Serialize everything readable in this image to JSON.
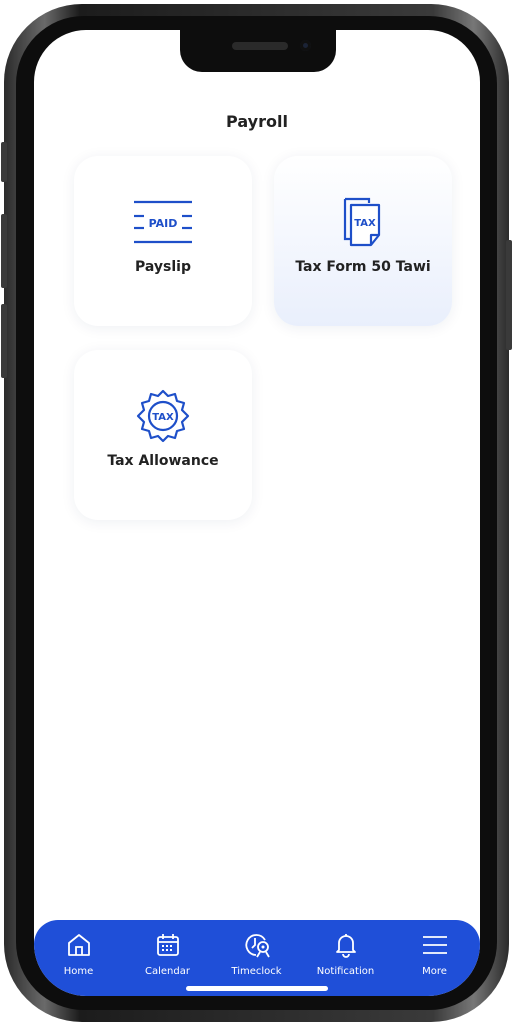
{
  "header": {
    "title": "Payroll"
  },
  "cards": [
    {
      "label": "Payslip",
      "icon": "paid-stamp-icon",
      "badge_text": "PAID"
    },
    {
      "label": "Tax Form 50 Tawi",
      "icon": "tax-form-icon",
      "badge_text": "TAX",
      "selected": true
    },
    {
      "label": "Tax Allowance",
      "icon": "tax-badge-icon",
      "badge_text": "TAX"
    }
  ],
  "bottom_nav": {
    "items": [
      {
        "label": "Home",
        "icon": "home-icon"
      },
      {
        "label": "Calendar",
        "icon": "calendar-icon"
      },
      {
        "label": "Timeclock",
        "icon": "timeclock-icon"
      },
      {
        "label": "Notification",
        "icon": "bell-icon"
      },
      {
        "label": "More",
        "icon": "menu-icon"
      }
    ]
  },
  "colors": {
    "accent": "#1f4fd8",
    "icon_blue": "#1e4fc9",
    "text": "#222222",
    "selected_card_tint": "#e9effc"
  }
}
